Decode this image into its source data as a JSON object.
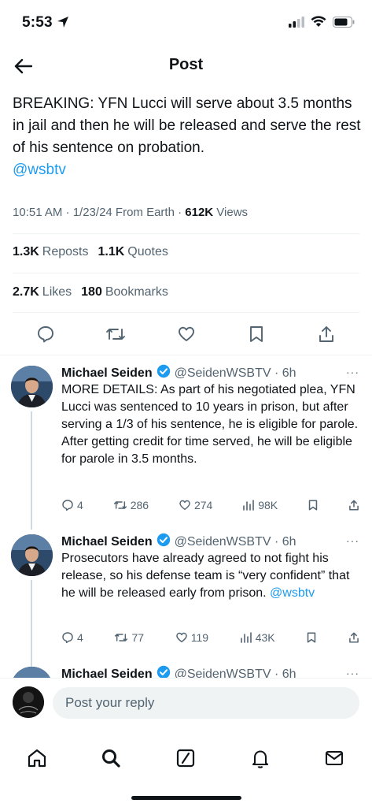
{
  "status_bar": {
    "time": "5:53"
  },
  "header": {
    "title": "Post"
  },
  "post": {
    "text": "BREAKING: YFN Lucci will serve about 3.5 months in jail and then he will be released and serve the rest of his sentence on probation.",
    "mention": "@wsbtv",
    "meta_prefix": "10:51 AM · 1/23/24 From Earth · ",
    "views_count": "612K",
    "views_label": " Views",
    "reposts_count": "1.3K",
    "reposts_label": "Reposts",
    "quotes_count": "1.1K",
    "quotes_label": "Quotes",
    "likes_count": "2.7K",
    "likes_label": "Likes",
    "bookmarks_count": "180",
    "bookmarks_label": "Bookmarks"
  },
  "replies": [
    {
      "name": "Michael Seiden",
      "handle": "@SeidenWSBTV · 6h",
      "more": "···",
      "text": "MORE DETAILS: As part of his negotiated plea, YFN Lucci was sentenced to 10 years in prison, but after serving a 1/3 of his sentence, he is eligible for parole. After getting credit for time served, he will be eligible for parole in 3.5 months.",
      "mention": "",
      "replies_count": "4",
      "reposts_count": "286",
      "likes_count": "274",
      "views_count": "98K"
    },
    {
      "name": "Michael Seiden",
      "handle": "@SeidenWSBTV · 6h",
      "more": "···",
      "text": "Prosecutors have already agreed to not fight his release, so his defense team is “very confident” that he will be released early from prison. ",
      "mention": "@wsbtv",
      "replies_count": "4",
      "reposts_count": "77",
      "likes_count": "119",
      "views_count": "43K"
    },
    {
      "name": "Michael Seiden",
      "handle": "@SeidenWSBTV · 6h",
      "more": "···"
    }
  ],
  "reply_bar": {
    "placeholder": "Post your reply"
  },
  "colors": {
    "accent": "#1d9bf0",
    "text": "#0f1419",
    "muted": "#536471",
    "border": "#eff3f4"
  },
  "icons": [
    "location-arrow-icon",
    "signal-icon",
    "wifi-icon",
    "battery-icon",
    "back-arrow-icon",
    "reply-icon",
    "repost-icon",
    "like-icon",
    "bookmark-icon",
    "share-icon",
    "verified-badge-icon",
    "views-icon",
    "home-icon",
    "search-icon",
    "grok-icon",
    "notifications-icon",
    "messages-icon"
  ]
}
